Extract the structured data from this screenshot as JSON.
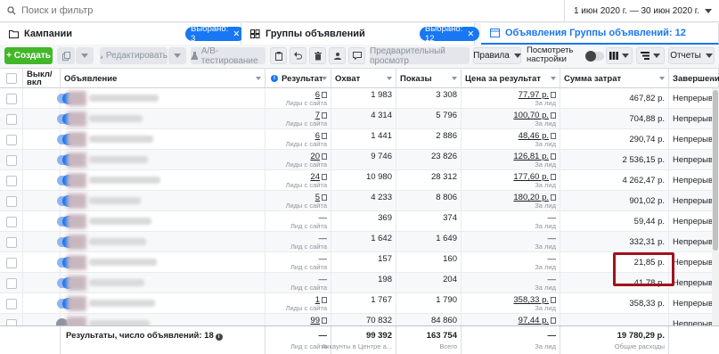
{
  "search": {
    "placeholder": "Поиск и фильтр"
  },
  "date_range": "1 июн 2020 г. — 30 июн 2020 г.",
  "tabs": [
    {
      "label": "Кампании",
      "pill": "Выбрано: 3"
    },
    {
      "label": "Группы объявлений",
      "pill": "Выбрано: 12"
    },
    {
      "label": "Объявления Группы объявлений: 12"
    }
  ],
  "toolbar": {
    "create": "+ Создать",
    "edit": "Редактировать",
    "ab_test": "A/B-тестирование",
    "preview": "Предварительный просмотр",
    "rules": "Правила",
    "view_settings_1": "Посмотреть",
    "view_settings_2": "настройки",
    "reports": "Отчеты"
  },
  "columns": {
    "toggle": "Выкл/ вкл",
    "ad": "Объявление",
    "result": "Результат",
    "reach": "Охват",
    "impressions": "Показы",
    "cost_per_result": "Цена за результат",
    "amount_spent": "Сумма затрат",
    "end": "Завершение"
  },
  "rows": [
    {
      "on": true,
      "result": "6",
      "result_sub": "Лиды с сайта",
      "reach": "1 983",
      "impressions": "3 308",
      "cpr": "77,97 р.",
      "cpr_sub": "За лид",
      "spent": "467,82 р.",
      "end": "Непрерывн..."
    },
    {
      "on": true,
      "result": "7",
      "result_sub": "Лиды с сайта",
      "reach": "4 314",
      "impressions": "5 796",
      "cpr": "100,70 р.",
      "cpr_sub": "За лид",
      "spent": "704,88 р.",
      "end": "Непрерывн..."
    },
    {
      "on": true,
      "result": "6",
      "result_sub": "Лиды с сайта",
      "reach": "1 441",
      "impressions": "2 886",
      "cpr": "48,46 р.",
      "cpr_sub": "За лид",
      "spent": "290,74 р.",
      "end": "Непрерывн..."
    },
    {
      "on": true,
      "result": "20",
      "result_sub": "Лиды с сайта",
      "reach": "9 746",
      "impressions": "23 826",
      "cpr": "126,81 р.",
      "cpr_sub": "За лид",
      "spent": "2 536,15 р.",
      "end": "Непрерывн..."
    },
    {
      "on": true,
      "result": "24",
      "result_sub": "Лиды с сайта",
      "reach": "10 980",
      "impressions": "28 312",
      "cpr": "177,60 р.",
      "cpr_sub": "За лид",
      "spent": "4 262,47 р.",
      "end": "Непрерывн..."
    },
    {
      "on": true,
      "result": "5",
      "result_sub": "Лиды с сайта",
      "reach": "4 233",
      "impressions": "8 806",
      "cpr": "180,20 р.",
      "cpr_sub": "За лид",
      "spent": "901,02 р.",
      "end": "Непрерывн..."
    },
    {
      "on": true,
      "result": "—",
      "result_sub": "Лид с сайта",
      "reach": "369",
      "impressions": "374",
      "cpr": "—",
      "cpr_sub": "За лид",
      "spent": "59,44 р.",
      "end": "Непрерывн..."
    },
    {
      "on": true,
      "result": "—",
      "result_sub": "Лид с сайта",
      "reach": "1 642",
      "impressions": "1 649",
      "cpr": "—",
      "cpr_sub": "За лид",
      "spent": "332,31 р.",
      "end": "Непрерывн..."
    },
    {
      "on": true,
      "result": "—",
      "result_sub": "Лид с сайта",
      "reach": "157",
      "impressions": "160",
      "cpr": "—",
      "cpr_sub": "За лид",
      "spent": "21,85 р.",
      "end": "Непрерывн..."
    },
    {
      "on": true,
      "result": "—",
      "result_sub": "Лид с сайта",
      "reach": "198",
      "impressions": "204",
      "cpr": "—",
      "cpr_sub": "За лид",
      "spent": "41,78 р.",
      "end": "Непрерывн..."
    },
    {
      "on": true,
      "result": "1",
      "result_sub": "Лиды с сайта",
      "reach": "1 767",
      "impressions": "1 790",
      "cpr": "358,33 р.",
      "cpr_sub": "За лид",
      "spent": "358,33 р.",
      "end": "Непрерывн..."
    },
    {
      "on": false,
      "result": "99",
      "result_sub": "",
      "reach": "70 832",
      "impressions": "84 860",
      "cpr": "97,44 р.",
      "cpr_sub": "",
      "spent": "",
      "end": "Непрерывн..."
    }
  ],
  "footer": {
    "label": "Результаты, число объявлений: 18",
    "result": "—",
    "result_sub": "Лид с сайта",
    "reach": "99 392",
    "reach_sub": "Аккаунты в Центре а...",
    "impressions": "163 754",
    "impressions_sub": "Всего",
    "cpr": "—",
    "cpr_sub": "За лид",
    "spent": "19 780,29 р.",
    "spent_sub": "Общие расходы"
  },
  "colors": {
    "accent": "#1877f2",
    "create": "#42b72a",
    "highlight": "#a1121d"
  }
}
